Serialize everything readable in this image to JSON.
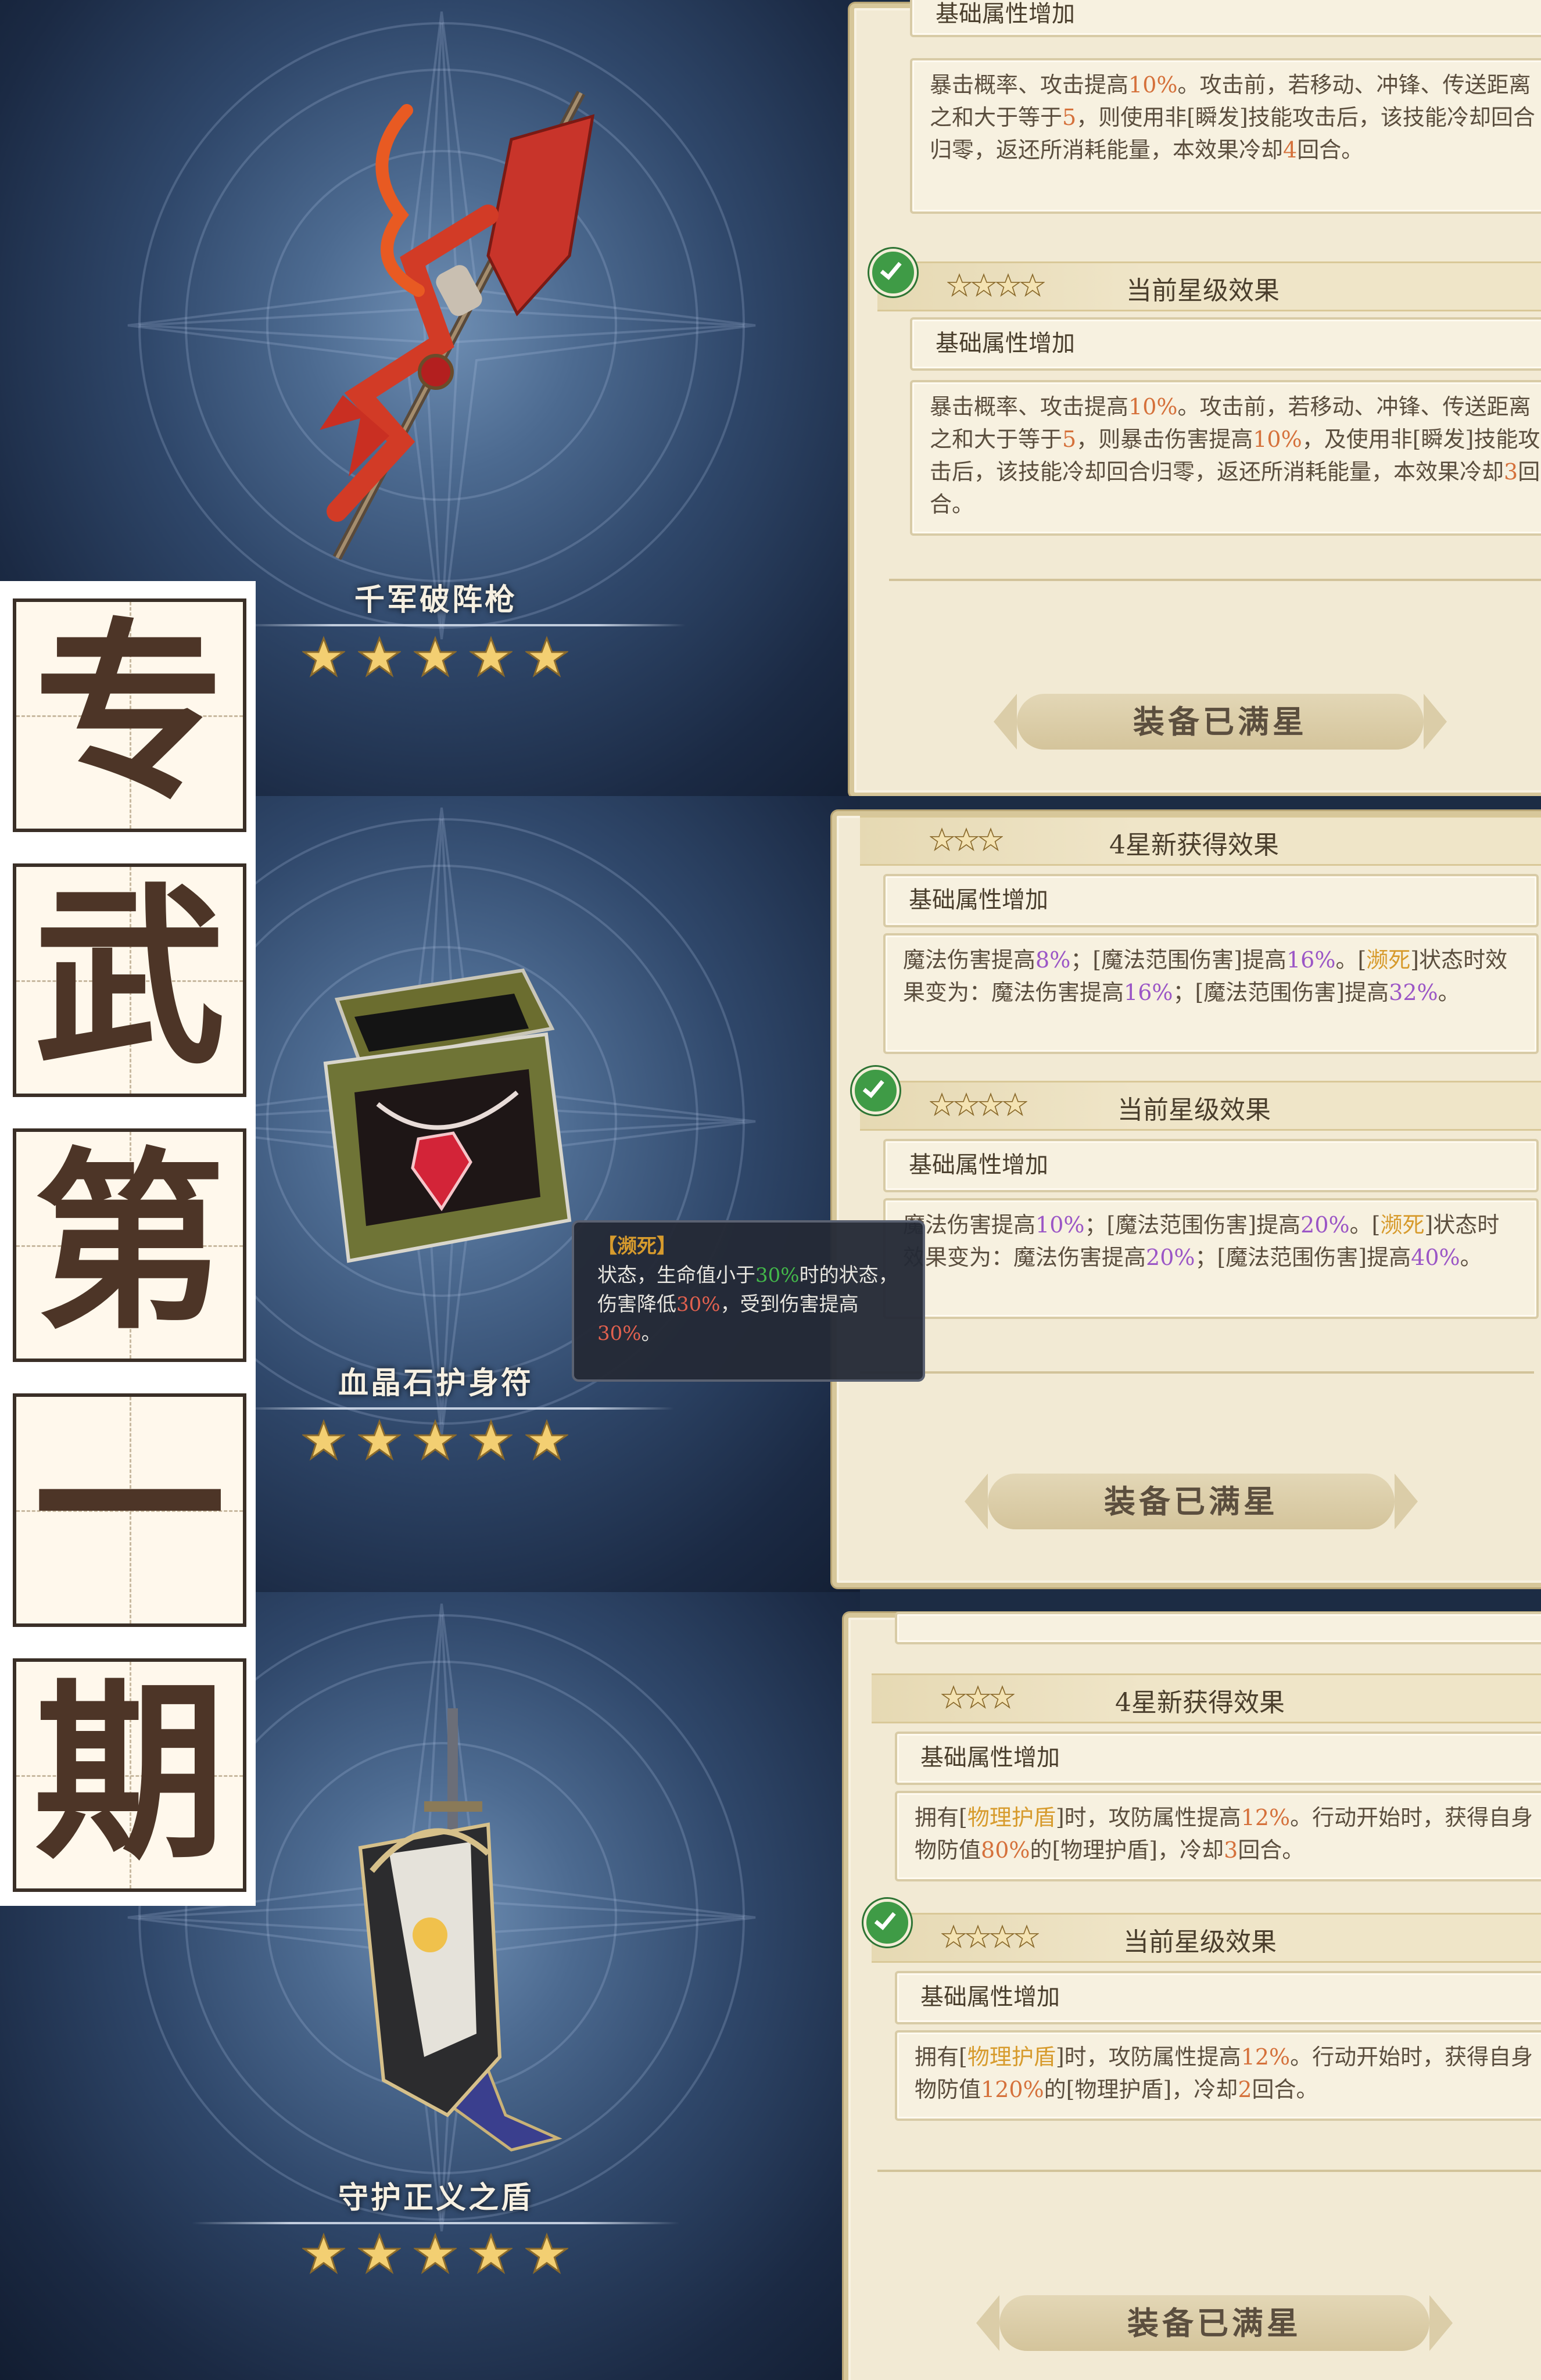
{
  "title_column": {
    "chars": [
      "专",
      "武",
      "第",
      "一",
      "期"
    ]
  },
  "colors": {
    "orange": "#d5713b",
    "purple": "#9b56c6",
    "gold": "#d79b2d",
    "green": "#43b84a",
    "star": "#f3cf72"
  },
  "items": [
    {
      "name": "千军破阵枪",
      "icon": "spear-with-red-banner-icon",
      "rating_stars": 5,
      "panel": {
        "partial_header": "基础属性增加",
        "prev_text_1": "暴击概率、攻击提高",
        "prev_v1": "10%",
        "prev_text_2": "。攻击前，若移动、冲锋、传送距离之和大于等于",
        "prev_v2": "5",
        "prev_text_3": "，则使用非[瞬发]技能攻击后，该技能冷却回合归零，返还所消耗能量，本效果冷却",
        "prev_v3": "4",
        "prev_text_4": "回合。",
        "current_title": "当前星级效果",
        "current_stars": 4,
        "current_attr_label": "基础属性增加",
        "cur_text_1": "暴击概率、攻击提高",
        "cur_v1": "10%",
        "cur_text_2": "。攻击前，若移动、冲锋、传送距离之和大于等于",
        "cur_v2": "5",
        "cur_text_3": "，则暴击伤害提高",
        "cur_v3": "10%",
        "cur_text_4": "，及使用非[瞬发]技能攻击后，该技能冷却回合归零，返还所消耗能量，本效果冷却",
        "cur_v4": "3",
        "cur_text_5": "回合。",
        "button_label": "装备已满星"
      }
    },
    {
      "name": "血晶石护身符",
      "icon": "red-gem-necklace-in-box-icon",
      "rating_stars": 5,
      "tooltip": {
        "title": "【濒死】",
        "t1": "状态，生命值小于",
        "v1": "30%",
        "t2": "时的状态，伤害降低",
        "v2": "30%",
        "t3": "，受到伤害提高",
        "v3": "30%",
        "t4": "。"
      },
      "panel": {
        "new_title": "4星新获得效果",
        "new_stars": 3,
        "new_attr_label": "基础属性增加",
        "new_t1": "魔法伤害提高",
        "new_v1": "8%",
        "new_t2": "；[魔法范围伤害]提高",
        "new_v2": "16%",
        "new_t3": "。[",
        "new_kw": "濒死",
        "new_t4": "]状态时效果变为：魔法伤害提高",
        "new_v3": "16%",
        "new_t5": "；[魔法范围伤害]提高",
        "new_v4": "32%",
        "new_t6": "。",
        "current_title": "当前星级效果",
        "current_stars": 4,
        "current_attr_label": "基础属性增加",
        "cur_t1": "魔法伤害提高",
        "cur_v1": "10%",
        "cur_t2": "；[魔法范围伤害]提高",
        "cur_v2": "20%",
        "cur_t3": "。[",
        "cur_kw": "濒死",
        "cur_t4": "]状态时效果变为：魔法伤害提高",
        "cur_v3": "20%",
        "cur_t5": "；[魔法范围伤害]提高",
        "cur_v4": "40%",
        "cur_t6": "。",
        "button_label": "装备已满星"
      }
    },
    {
      "name": "守护正义之盾",
      "icon": "shield-with-sword-and-blue-cape-icon",
      "rating_stars": 5,
      "panel": {
        "new_title": "4星新获得效果",
        "new_stars": 3,
        "new_attr_label": "基础属性增加",
        "new_t1": "拥有[",
        "new_kw": "物理护盾",
        "new_t2": "]时，攻防属性提高",
        "new_v1": "12%",
        "new_t3": "。行动开始时，获得自身物防值",
        "new_v2": "80%",
        "new_t4": "的[物理护盾]，冷却",
        "new_v3": "3",
        "new_t5": "回合。",
        "current_title": "当前星级效果",
        "current_stars": 4,
        "current_attr_label": "基础属性增加",
        "cur_t1": "拥有[",
        "cur_kw": "物理护盾",
        "cur_t2": "]时，攻防属性提高",
        "cur_v1": "12%",
        "cur_t3": "。行动开始时，获得自身物防值",
        "cur_v2": "120%",
        "cur_t4": "的[物理护盾]，冷却",
        "cur_v3": "2",
        "cur_t5": "回合。",
        "button_label": "装备已满星"
      }
    }
  ]
}
